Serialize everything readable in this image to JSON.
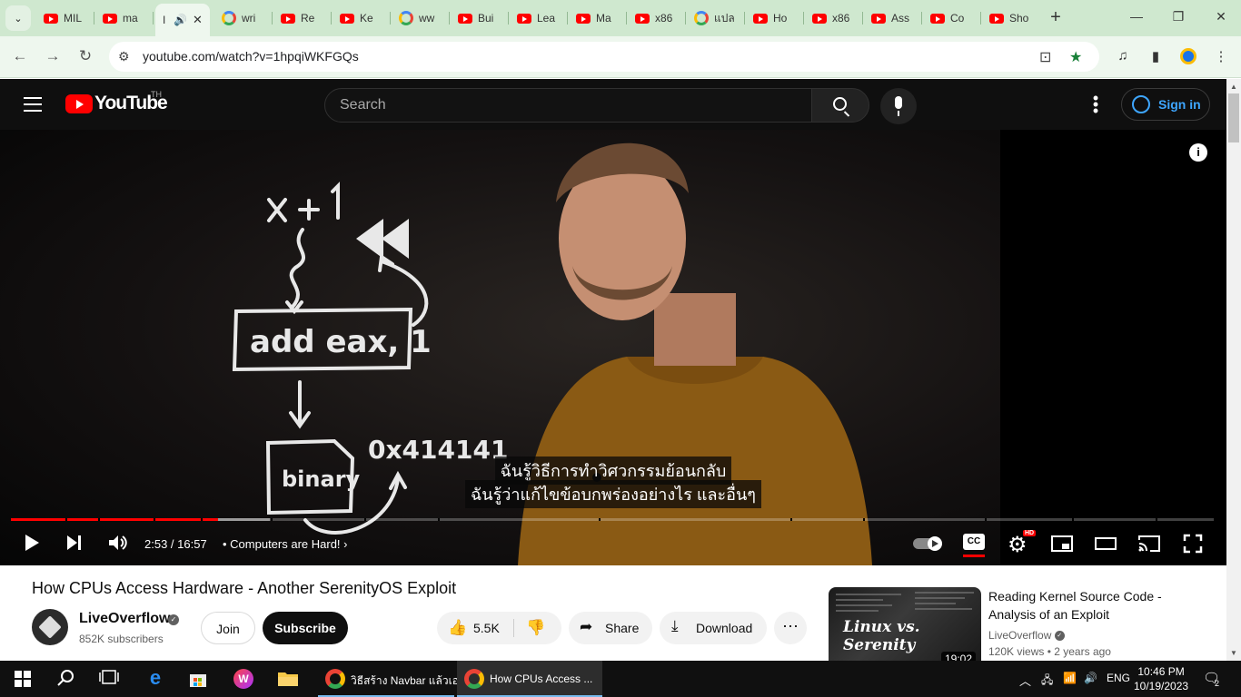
{
  "browser": {
    "tabs": [
      {
        "label": "MIL",
        "icon": "youtube"
      },
      {
        "label": "ma",
        "icon": "youtube"
      },
      {
        "label": "I",
        "icon": "speaker",
        "active": true
      },
      {
        "label": "wri",
        "icon": "google"
      },
      {
        "label": "Re",
        "icon": "youtube"
      },
      {
        "label": "Ke",
        "icon": "youtube"
      },
      {
        "label": "ww",
        "icon": "google"
      },
      {
        "label": "Bui",
        "icon": "youtube"
      },
      {
        "label": "Lea",
        "icon": "youtube"
      },
      {
        "label": "Ma",
        "icon": "youtube"
      },
      {
        "label": "x86",
        "icon": "youtube"
      },
      {
        "label": "แปล",
        "icon": "google"
      },
      {
        "label": "Ho",
        "icon": "youtube"
      },
      {
        "label": "x86",
        "icon": "youtube"
      },
      {
        "label": "Ass",
        "icon": "youtube"
      },
      {
        "label": "Co",
        "icon": "youtube"
      },
      {
        "label": "Sho",
        "icon": "youtube"
      }
    ],
    "url": "youtube.com/watch?v=1hpqiWKFGQs"
  },
  "youtube": {
    "logo_text": "YouTube",
    "country_code": "TH",
    "search_placeholder": "Search",
    "sign_in": "Sign in"
  },
  "player": {
    "caption_line1": "ฉันรู้วิธีการทำวิศวกรรมย้อนกลับ",
    "caption_line2": "ฉันรู้ว่าแก้ไขข้อบกพร่องอย่างไร และอื่นๆ",
    "time": "2:53 / 16:57",
    "chapter": "• Computers are Hard!",
    "progress_fraction": 0.172,
    "buffered_fraction": 0.215,
    "quality_badge": "HD",
    "cc_label": "CC"
  },
  "video": {
    "title": "How CPUs Access Hardware - Another SerenityOS Exploit",
    "channel": "LiveOverflow",
    "subscribers": "852K subscribers",
    "join": "Join",
    "subscribe": "Subscribe",
    "likes": "5.5K",
    "share": "Share",
    "download": "Download"
  },
  "recommendation": {
    "title": "Reading Kernel Source Code - Analysis of an Exploit",
    "channel": "LiveOverflow",
    "views": "120K views",
    "age": "• 2 years ago",
    "duration": "19:02",
    "thumb_text": "Linux vs. Serenity"
  },
  "taskbar": {
    "apps": [
      {
        "label": "วิธีสร้าง Navbar แล้วเอ..."
      },
      {
        "label": "How CPUs Access ..."
      }
    ],
    "language": "ENG",
    "time": "10:46 PM",
    "date": "10/19/2023",
    "notifications": "2"
  },
  "colors": {
    "youtube_red": "#ff0000",
    "dark": "#0f0f0f",
    "link_blue": "#3ea6ff",
    "browser_green": "#cfe8cf"
  }
}
